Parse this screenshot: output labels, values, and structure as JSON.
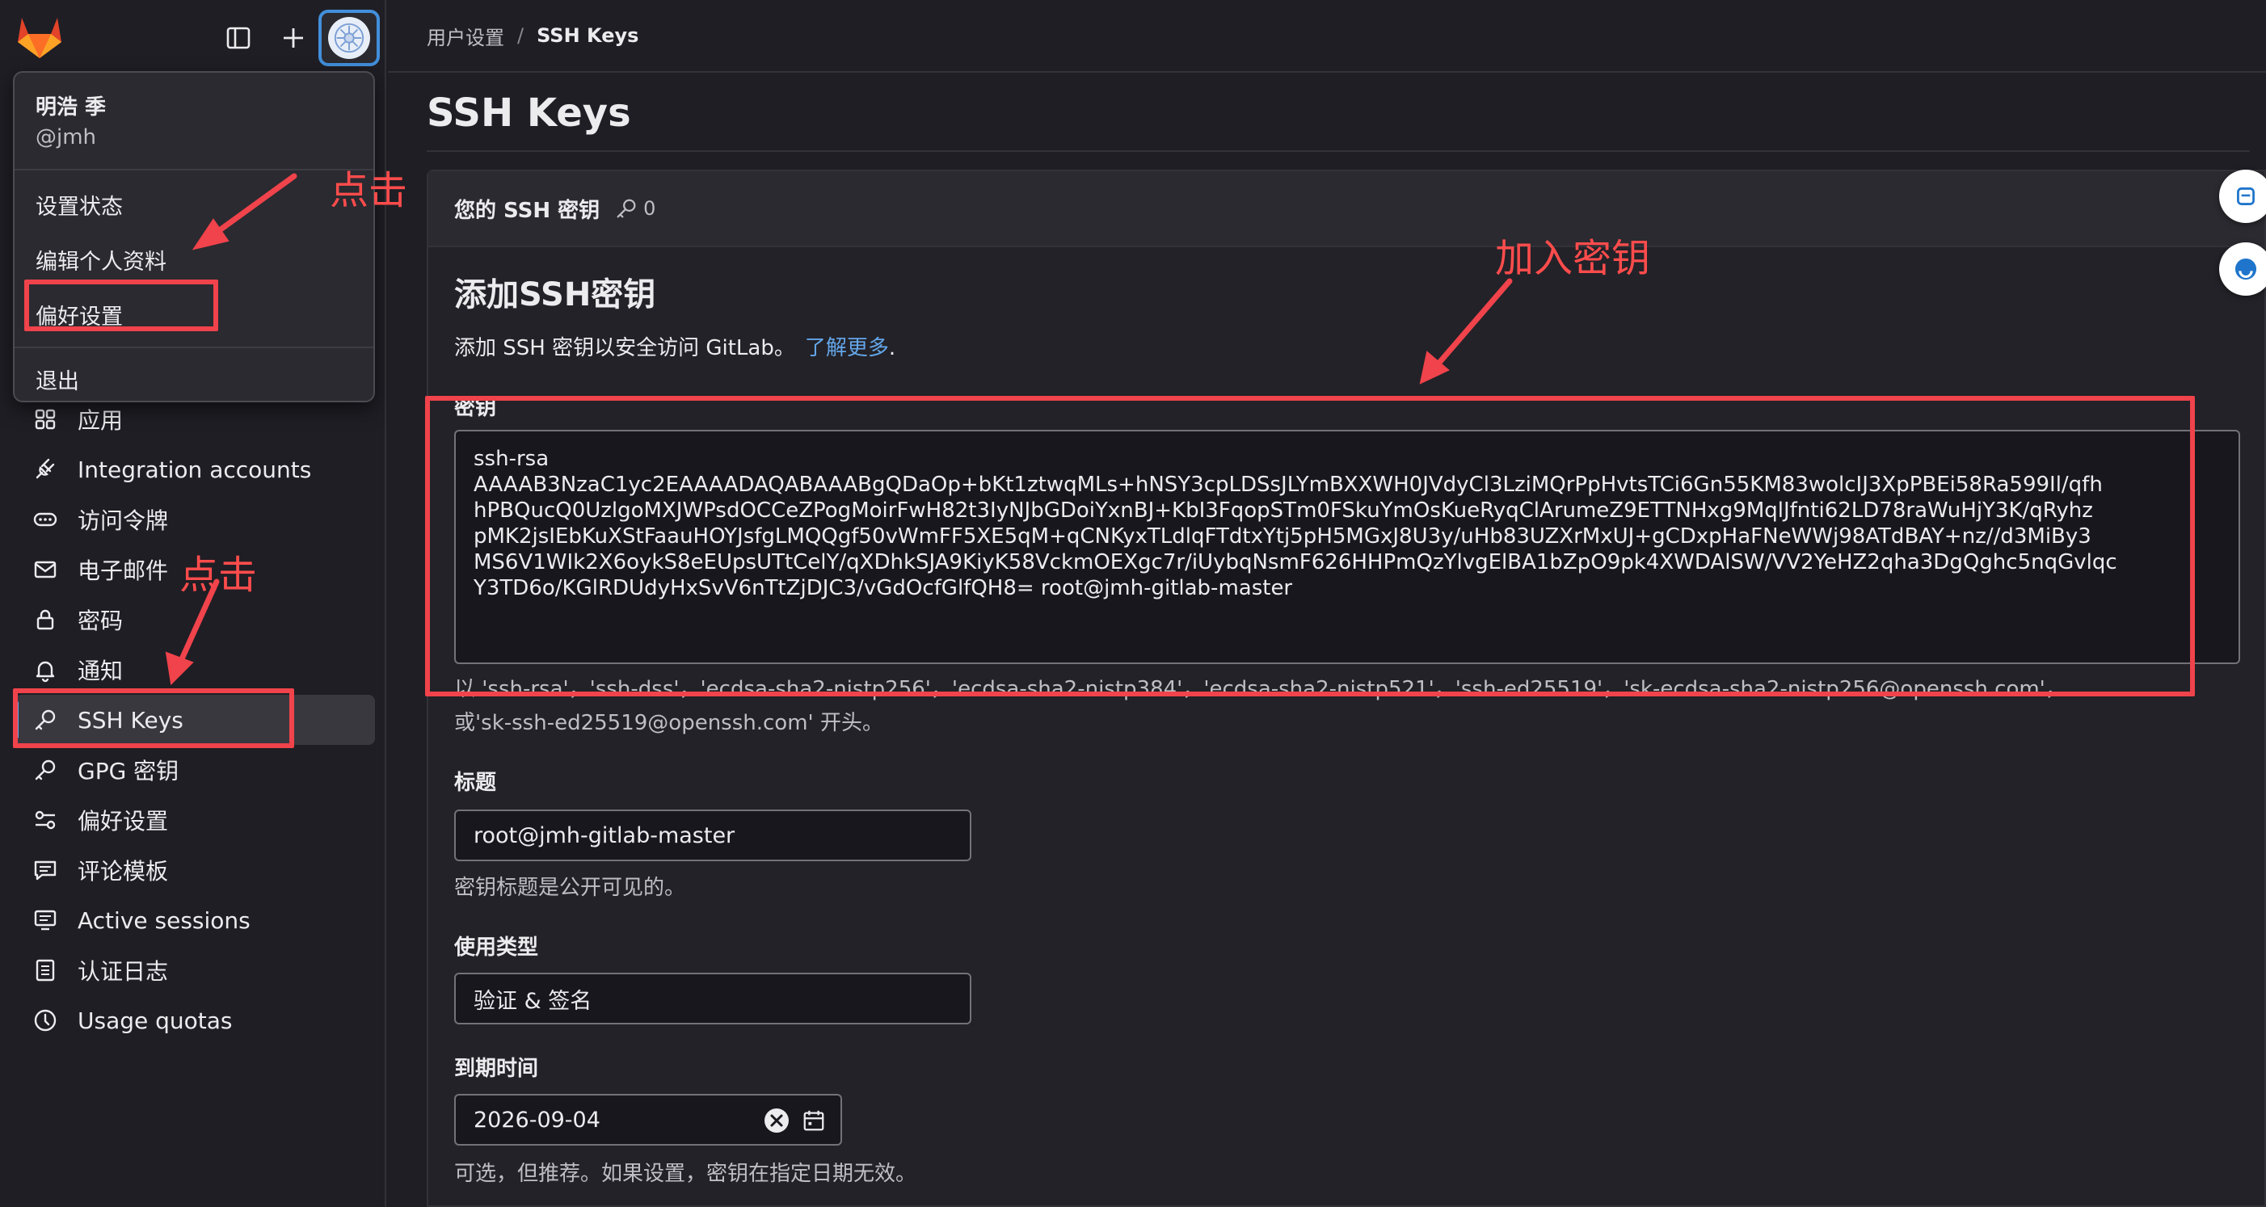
{
  "header": {
    "breadcrumb_parent": "用户设置",
    "breadcrumb_separator": "/",
    "breadcrumb_current": "SSH Keys"
  },
  "user_menu": {
    "name": "明浩 季",
    "username": "@jmh",
    "items": [
      "设置状态",
      "编辑个人资料",
      "偏好设置"
    ],
    "signout": "退出"
  },
  "sidebar": {
    "items": [
      {
        "label": "应用",
        "icon": "applications-icon"
      },
      {
        "label": "Integration accounts",
        "icon": "plug-icon"
      },
      {
        "label": "访问令牌",
        "icon": "token-icon"
      },
      {
        "label": "电子邮件",
        "icon": "mail-icon"
      },
      {
        "label": "密码",
        "icon": "lock-icon"
      },
      {
        "label": "通知",
        "icon": "bell-icon"
      },
      {
        "label": "SSH Keys",
        "icon": "key-icon",
        "active": true
      },
      {
        "label": "GPG 密钥",
        "icon": "key-icon"
      },
      {
        "label": "偏好设置",
        "icon": "preferences-icon"
      },
      {
        "label": "评论模板",
        "icon": "comment-icon"
      },
      {
        "label": "Active sessions",
        "icon": "monitor-icon"
      },
      {
        "label": "认证日志",
        "icon": "log-icon"
      },
      {
        "label": "Usage quotas",
        "icon": "quota-icon"
      }
    ]
  },
  "page": {
    "title": "SSH Keys",
    "panel_title": "您的 SSH 密钥",
    "key_count": "0",
    "form_title": "添加SSH密钥",
    "form_desc": "添加 SSH 密钥以安全访问 GitLab。",
    "learn_more": "了解更多",
    "desc_period": ".",
    "key_label": "密钥",
    "key_value_lines": [
      "ssh-rsa",
      "AAAAB3NzaC1yc2EAAAADAQABAAABgQDaOp+bKt1ztwqMLs+hNSY3cpLDSsJLYmBXXWH0JVdyCl3LziMQrPpHvtsTCi6Gn55KM83wolcIJ3XpPBEi58Ra599Il/qfh",
      "hPBQucQ0UzlgoMXJWPsdOCCeZPogMoirFwH82t3IyNJbGDoiYxnBJ+KbI3FqopSTm0FSkuYmOsKueRyqClArumeZ9ETTNHxg9MqlJfnti62LD78raWuHjY3K/qRyhz",
      "pMK2jsIEbKuXStFaauHOYJsfgLMQQgf50vWmFF5XE5qM+qCNKyxTLdlqFTdtxYtj5pH5MGxJ8U3y/uHb83UZXrMxUJ+gCDxpHaFNeWWj98ATdBAY+nz//d3MiBy3",
      "MS6V1WIk2X6oykS8eEUpsUTtCelY/qXDhkSJA9KiyK58VckmOEXgc7r/iUybqNsmF626HHPmQzYlvgElBA1bZpO9pk4XWDAlSW/VV2YeHZ2qha3DgQghc5nqGvlqc",
      "Y3TD6o/KGlRDUdyHxSvV6nTtZjDJC3/vGdOcfGlfQH8= root@jmh-gitlab-master"
    ],
    "key_help_line1": "以 'ssh-rsa'，'ssh-dss'，'ecdsa-sha2-nistp256'，'ecdsa-sha2-nistp384'，'ecdsa-sha2-nistp521'，'ssh-ed25519'，'sk-ecdsa-sha2-nistp256@openssh.com'，",
    "key_help_line2": "或'sk-ssh-ed25519@openssh.com' 开头。",
    "title_label": "标题",
    "title_value": "root@jmh-gitlab-master",
    "title_help": "密钥标题是公开可见的。",
    "usage_label": "使用类型",
    "usage_value": "验证 & 签名",
    "expiry_label": "到期时间",
    "expiry_value": "2026-09-04",
    "expiry_help": "可选，但推荐。如果设置，密钥在指定日期无效。"
  },
  "annotations": {
    "click_1": "点击",
    "click_2": "点击",
    "add_key": "加入密钥",
    "color": "#f0434b"
  }
}
